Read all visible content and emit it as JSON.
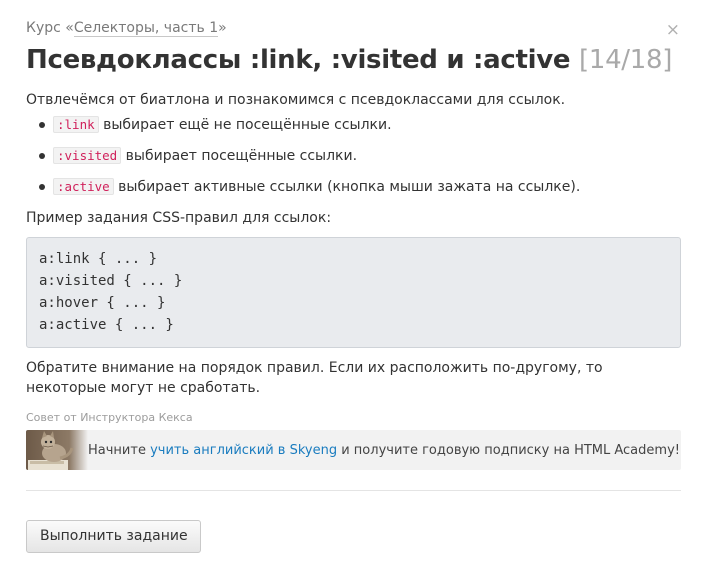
{
  "header": {
    "course_prefix": "Курс «",
    "course_link": "Селекторы, часть 1",
    "course_suffix": "»",
    "close_glyph": "×",
    "title": "Псевдоклассы :link, :visited и :active",
    "counter": "[14/18]"
  },
  "intro": "Отвлечёмся от биатлона и познакомимся с псевдоклассами для ссылок.",
  "items": [
    {
      "code": ":link",
      "text": " выбирает ещё не посещённые ссылки."
    },
    {
      "code": ":visited",
      "text": " выбирает посещённые ссылки."
    },
    {
      "code": ":active",
      "text": " выбирает активные ссылки (кнопка мыши зажата на ссылке)."
    }
  ],
  "example_label": "Пример задания CSS-правил для ссылок:",
  "code_lines": [
    "a:link { ... }",
    "a:visited { ... }",
    "a:hover { ... }",
    "a:active { ... }"
  ],
  "note": "Обратите внимание на порядок правил. Если их расположить по-другому, то некоторые могут не сработать.",
  "tip": {
    "caption": "Совет от Инструктора Кекса",
    "before": "Начните ",
    "link": "учить английский в Skyeng",
    "after": " и получите годовую подписку на HTML Academy!",
    "image_icon": "cat-instructor-icon"
  },
  "actions": {
    "submit_label": "Выполнить задание"
  }
}
